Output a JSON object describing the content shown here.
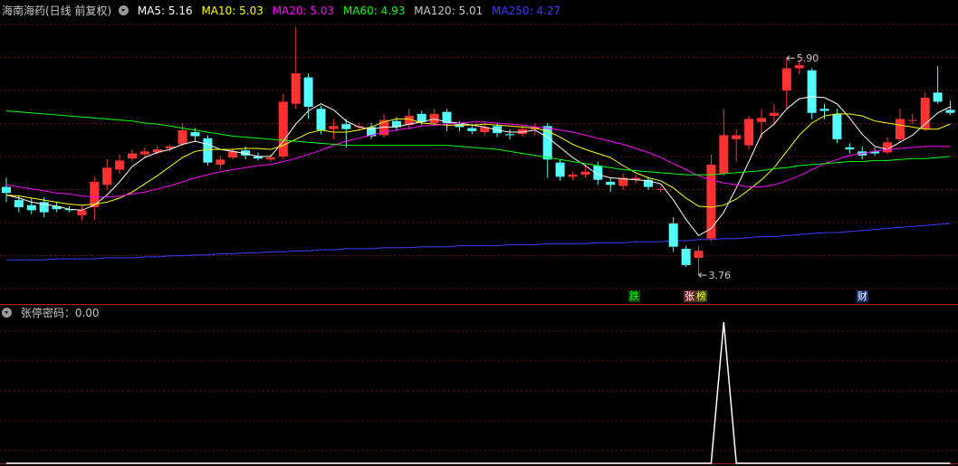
{
  "main_panel": {
    "title": "海南海药(日线 前复权)",
    "ma_legend": [
      {
        "label": "MA5: 5.16",
        "color": "#ffffff"
      },
      {
        "label": "MA10: 5.03",
        "color": "#ffff00"
      },
      {
        "label": "MA20: 5.03",
        "color": "#ff00ff"
      },
      {
        "label": "MA60: 4.93",
        "color": "#00ff00"
      },
      {
        "label": "MA120: 5.01",
        "color": "#c8c8c8"
      },
      {
        "label": "MA250: 4.27",
        "color": "#3c3cff"
      }
    ],
    "high_marker": "5.90",
    "low_marker": "3.76",
    "event_tags": [
      {
        "label": "跌",
        "color": "#00ff00",
        "bg": "#144014"
      },
      {
        "label": "张",
        "color": "#ffffff",
        "bg": "#702020"
      },
      {
        "label": "榜",
        "color": "#ffff00",
        "bg": "#404010"
      },
      {
        "label": "财",
        "color": "#ffffff",
        "bg": "#1a2e70"
      }
    ]
  },
  "sub_panel": {
    "title": "张停密码：0.00"
  },
  "chart_data": [
    {
      "type": "candlestick",
      "title": "海南海药(日线 前复权)",
      "up_color": "#ff3232",
      "down_color": "#54fcfc",
      "ylim": [
        3.6,
        6.25
      ],
      "candles": [
        [
          4.63,
          4.57,
          4.72,
          4.48
        ],
        [
          4.5,
          4.43,
          4.55,
          4.38
        ],
        [
          4.45,
          4.4,
          4.52,
          4.36
        ],
        [
          4.48,
          4.38,
          4.53,
          4.33
        ],
        [
          4.44,
          4.41,
          4.48,
          4.38
        ],
        [
          4.41,
          4.4,
          4.44,
          4.38
        ],
        [
          4.35,
          4.4,
          4.45,
          4.3
        ],
        [
          4.43,
          4.68,
          4.73,
          4.3
        ],
        [
          4.65,
          4.82,
          4.9,
          4.6
        ],
        [
          4.8,
          4.89,
          4.95,
          4.76
        ],
        [
          4.91,
          4.96,
          5.0,
          4.88
        ],
        [
          4.95,
          4.98,
          5.02,
          4.92
        ],
        [
          4.97,
          5.0,
          5.04,
          4.95
        ],
        [
          5.01,
          5.03,
          5.05,
          4.98
        ],
        [
          5.05,
          5.19,
          5.26,
          5.03
        ],
        [
          5.17,
          5.13,
          5.21,
          5.07
        ],
        [
          5.11,
          4.87,
          5.14,
          4.84
        ],
        [
          4.85,
          4.9,
          4.94,
          4.8
        ],
        [
          4.92,
          4.98,
          5.01,
          4.9
        ],
        [
          4.99,
          4.94,
          5.03,
          4.9
        ],
        [
          4.93,
          4.91,
          4.97,
          4.89
        ],
        [
          4.9,
          4.92,
          4.95,
          4.88
        ],
        [
          4.93,
          5.47,
          5.55,
          4.9
        ],
        [
          5.45,
          5.75,
          6.2,
          5.4
        ],
        [
          5.71,
          5.42,
          5.75,
          5.3
        ],
        [
          5.4,
          5.19,
          5.43,
          5.15
        ],
        [
          5.2,
          5.23,
          5.3,
          5.1
        ],
        [
          5.25,
          5.2,
          5.3,
          5.02
        ],
        [
          5.22,
          5.23,
          5.26,
          5.18
        ],
        [
          5.22,
          5.13,
          5.26,
          5.1
        ],
        [
          5.14,
          5.29,
          5.35,
          5.12
        ],
        [
          5.28,
          5.22,
          5.32,
          5.18
        ],
        [
          5.24,
          5.33,
          5.4,
          5.2
        ],
        [
          5.35,
          5.27,
          5.38,
          5.24
        ],
        [
          5.26,
          5.35,
          5.4,
          5.23
        ],
        [
          5.37,
          5.26,
          5.4,
          5.18
        ],
        [
          5.25,
          5.22,
          5.28,
          5.18
        ],
        [
          5.21,
          5.18,
          5.25,
          5.15
        ],
        [
          5.17,
          5.22,
          5.26,
          5.14
        ],
        [
          5.23,
          5.16,
          5.26,
          5.12
        ],
        [
          5.15,
          5.14,
          5.2,
          5.1
        ],
        [
          5.15,
          5.2,
          5.24,
          5.13
        ],
        [
          5.2,
          5.22,
          5.26,
          5.14
        ],
        [
          5.23,
          4.9,
          5.26,
          4.72
        ],
        [
          4.87,
          4.73,
          4.9,
          4.69
        ],
        [
          4.73,
          4.75,
          4.78,
          4.7
        ],
        [
          4.75,
          4.78,
          4.85,
          4.72
        ],
        [
          4.84,
          4.7,
          4.88,
          4.65
        ],
        [
          4.68,
          4.65,
          4.72,
          4.58
        ],
        [
          4.64,
          4.72,
          4.76,
          4.6
        ],
        [
          4.7,
          4.72,
          4.75,
          4.66
        ],
        [
          4.7,
          4.63,
          4.73,
          4.6
        ],
        [
          4.61,
          4.61,
          4.64,
          4.58
        ],
        [
          4.27,
          4.04,
          4.33,
          3.99
        ],
        [
          4.02,
          3.86,
          4.05,
          3.84
        ],
        [
          3.93,
          4.0,
          4.05,
          3.76
        ],
        [
          4.12,
          4.85,
          4.95,
          4.1
        ],
        [
          4.76,
          5.14,
          5.4,
          4.74
        ],
        [
          5.1,
          5.14,
          5.2,
          4.88
        ],
        [
          5.04,
          5.3,
          5.33,
          5.0
        ],
        [
          5.27,
          5.31,
          5.4,
          5.1
        ],
        [
          5.33,
          5.36,
          5.45,
          5.24
        ],
        [
          5.58,
          5.8,
          5.9,
          5.4
        ],
        [
          5.8,
          5.83,
          5.87,
          5.74
        ],
        [
          5.78,
          5.36,
          5.8,
          5.3
        ],
        [
          5.4,
          5.38,
          5.45,
          5.3
        ],
        [
          5.35,
          5.1,
          5.4,
          5.06
        ],
        [
          5.02,
          5.0,
          5.06,
          4.96
        ],
        [
          4.98,
          4.94,
          5.03,
          4.9
        ],
        [
          4.98,
          4.96,
          5.02,
          4.94
        ],
        [
          4.97,
          5.07,
          5.12,
          4.95
        ],
        [
          5.1,
          5.3,
          5.4,
          5.07
        ],
        [
          5.29,
          5.29,
          5.35,
          5.25
        ],
        [
          5.2,
          5.51,
          5.56,
          5.18
        ],
        [
          5.56,
          5.47,
          5.82,
          5.45
        ],
        [
          5.39,
          5.36,
          5.48,
          5.34
        ]
      ],
      "ma_lines": [
        {
          "name": "MA5",
          "color": "#ffffff",
          "values": [
            4.55,
            4.52,
            4.48,
            4.46,
            4.44,
            4.41,
            4.4,
            4.45,
            4.55,
            4.68,
            4.83,
            4.92,
            4.97,
            5.0,
            5.05,
            5.08,
            5.05,
            5.0,
            4.98,
            4.96,
            4.93,
            4.93,
            5.08,
            5.25,
            5.38,
            5.45,
            5.39,
            5.28,
            5.22,
            5.2,
            5.22,
            5.22,
            5.25,
            5.27,
            5.3,
            5.27,
            5.26,
            5.24,
            5.22,
            5.19,
            5.17,
            5.17,
            5.19,
            5.12,
            5.02,
            4.92,
            4.84,
            4.75,
            4.72,
            4.71,
            4.7,
            4.69,
            4.66,
            4.5,
            4.31,
            4.15,
            4.22,
            4.38,
            4.62,
            4.88,
            5.15,
            5.25,
            5.4,
            5.5,
            5.52,
            5.51,
            5.45,
            5.31,
            5.15,
            5.03,
            5.0,
            5.07,
            5.14,
            5.25,
            5.36,
            5.42
          ]
        },
        {
          "name": "MA10",
          "color": "#ffff00",
          "values": [
            4.55,
            4.54,
            4.52,
            4.5,
            4.48,
            4.46,
            4.45,
            4.46,
            4.48,
            4.52,
            4.58,
            4.66,
            4.74,
            4.83,
            4.92,
            4.98,
            5.0,
            5.0,
            5.0,
            5.01,
            5.01,
            5.0,
            5.04,
            5.1,
            5.16,
            5.19,
            5.17,
            5.17,
            5.19,
            5.22,
            5.27,
            5.3,
            5.3,
            5.26,
            5.25,
            5.24,
            5.24,
            5.24,
            5.25,
            5.24,
            5.23,
            5.22,
            5.21,
            5.18,
            5.12,
            5.05,
            5.0,
            4.96,
            4.92,
            4.84,
            4.77,
            4.72,
            4.69,
            4.62,
            4.52,
            4.44,
            4.43,
            4.45,
            4.51,
            4.6,
            4.7,
            4.82,
            4.98,
            5.14,
            5.26,
            5.33,
            5.35,
            5.35,
            5.33,
            5.28,
            5.26,
            5.24,
            5.22,
            5.2,
            5.2,
            5.25
          ]
        },
        {
          "name": "MA20",
          "color": "#ff00ff",
          "values": [
            4.65,
            4.63,
            4.61,
            4.59,
            4.57,
            4.56,
            4.54,
            4.53,
            4.53,
            4.54,
            4.56,
            4.58,
            4.61,
            4.64,
            4.68,
            4.72,
            4.75,
            4.78,
            4.8,
            4.82,
            4.84,
            4.85,
            4.88,
            4.91,
            4.95,
            4.99,
            5.04,
            5.08,
            5.11,
            5.14,
            5.17,
            5.19,
            5.21,
            5.23,
            5.24,
            5.25,
            5.26,
            5.27,
            5.27,
            5.26,
            5.25,
            5.24,
            5.22,
            5.21,
            5.19,
            5.17,
            5.14,
            5.11,
            5.08,
            5.05,
            5.01,
            4.97,
            4.92,
            4.86,
            4.8,
            4.74,
            4.7,
            4.67,
            4.65,
            4.63,
            4.63,
            4.65,
            4.69,
            4.74,
            4.8,
            4.86,
            4.9,
            4.94,
            4.96,
            4.98,
            5.0,
            5.01,
            5.02,
            5.03,
            5.03,
            5.03
          ]
        },
        {
          "name": "MA60",
          "color": "#00ff00",
          "values": [
            5.38,
            5.37,
            5.36,
            5.35,
            5.34,
            5.33,
            5.32,
            5.31,
            5.3,
            5.29,
            5.28,
            5.26,
            5.25,
            5.23,
            5.21,
            5.19,
            5.17,
            5.15,
            5.13,
            5.12,
            5.11,
            5.1,
            5.09,
            5.08,
            5.07,
            5.06,
            5.05,
            5.04,
            5.04,
            5.04,
            5.04,
            5.04,
            5.04,
            5.04,
            5.04,
            5.04,
            5.03,
            5.02,
            5.01,
            5.0,
            4.98,
            4.96,
            4.94,
            4.92,
            4.9,
            4.88,
            4.86,
            4.84,
            4.82,
            4.8,
            4.79,
            4.78,
            4.77,
            4.76,
            4.75,
            4.75,
            4.75,
            4.76,
            4.77,
            4.78,
            4.79,
            4.81,
            4.82,
            4.84,
            4.85,
            4.86,
            4.87,
            4.88,
            4.88,
            4.89,
            4.89,
            4.9,
            4.91,
            4.91,
            4.92,
            4.93
          ]
        },
        {
          "name": "MA250",
          "color": "#3c3cff",
          "values": [
            3.91,
            3.91,
            3.91,
            3.91,
            3.92,
            3.92,
            3.92,
            3.92,
            3.93,
            3.93,
            3.93,
            3.94,
            3.94,
            3.95,
            3.95,
            3.96,
            3.96,
            3.97,
            3.97,
            3.98,
            3.98,
            3.99,
            3.99,
            4.0,
            4.0,
            4.01,
            4.01,
            4.02,
            4.02,
            4.02,
            4.03,
            4.03,
            4.03,
            4.04,
            4.04,
            4.04,
            4.05,
            4.05,
            4.05,
            4.05,
            4.06,
            4.06,
            4.06,
            4.07,
            4.07,
            4.07,
            4.07,
            4.08,
            4.08,
            4.08,
            4.09,
            4.09,
            4.09,
            4.1,
            4.1,
            4.11,
            4.11,
            4.12,
            4.12,
            4.13,
            4.14,
            4.14,
            4.15,
            4.16,
            4.17,
            4.18,
            4.18,
            4.19,
            4.2,
            4.21,
            4.22,
            4.23,
            4.24,
            4.25,
            4.26,
            4.27
          ]
        }
      ],
      "annotations": [
        {
          "text": "5.90",
          "index": 62,
          "value": 5.9
        },
        {
          "text": "3.76",
          "index": 55,
          "value": 3.76
        }
      ]
    },
    {
      "type": "line",
      "title": "张停密码：0.00",
      "color": "#ffffff",
      "ylim": [
        0,
        1
      ],
      "values": [
        0,
        0,
        0,
        0,
        0,
        0,
        0,
        0,
        0,
        0,
        0,
        0,
        0,
        0,
        0,
        0,
        0,
        0,
        0,
        0,
        0,
        0,
        0,
        0,
        0,
        0,
        0,
        0,
        0,
        0,
        0,
        0,
        0,
        0,
        0,
        0,
        0,
        0,
        0,
        0,
        0,
        0,
        0,
        0,
        0,
        0,
        0,
        0,
        0,
        0,
        0,
        0,
        0,
        0,
        0,
        0,
        0,
        1,
        0,
        0,
        0,
        0,
        0,
        0,
        0,
        0,
        0,
        0,
        0,
        0,
        0,
        0,
        0,
        0,
        0,
        0
      ]
    }
  ]
}
